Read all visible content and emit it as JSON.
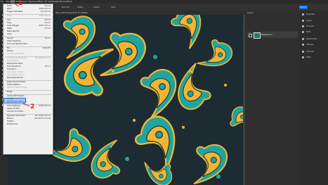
{
  "menubar": {
    "items": [
      "Ps",
      "File",
      "Edit",
      "Image",
      "Layer",
      "Type",
      "Select",
      "Filter",
      "3D",
      "View",
      "Plugins",
      "Window",
      "Help"
    ]
  },
  "options_bar": {
    "mode_label": "Normal",
    "opacity": "100%",
    "flow": "100%",
    "smoothing": "10%",
    "share": "Share"
  },
  "document": {
    "tab_title": "fiber_seamless.jpg @ 66.7% (RGB/8)"
  },
  "layers_panel": {
    "title": "Layers",
    "layer_name": "Background"
  },
  "properties_panel": {
    "items": [
      "Properties",
      "Layers",
      "Channels",
      "Paths",
      "Adjustments",
      "Libraries",
      "Channels",
      "Paths"
    ]
  },
  "edit_menu": {
    "items": [
      {
        "label": "Undo",
        "shortcut": "Ctrl+Z",
        "dim": false
      },
      {
        "label": "Redo",
        "shortcut": "Shift+Ctrl+Z",
        "dim": false
      },
      {
        "label": "Toggle Last State",
        "shortcut": "Alt+Ctrl+Z",
        "dim": false
      },
      {
        "sep": true
      },
      {
        "label": "Fade...",
        "shortcut": "Shift+Ctrl+F",
        "dim": true
      },
      {
        "sep": true
      },
      {
        "label": "Cut",
        "shortcut": "Ctrl+X",
        "dim": false
      },
      {
        "label": "Copy",
        "shortcut": "Ctrl+C",
        "dim": false
      },
      {
        "label": "Copy Merged",
        "shortcut": "Shift+Ctrl+C",
        "dim": false
      },
      {
        "label": "Paste",
        "shortcut": "Ctrl+V",
        "dim": false
      },
      {
        "label": "Paste Special",
        "shortcut": "",
        "dim": false
      },
      {
        "label": "Clear",
        "shortcut": "",
        "dim": false
      },
      {
        "sep": true
      },
      {
        "label": "Search",
        "shortcut": "Ctrl+F",
        "dim": false
      },
      {
        "label": "Check Spelling...",
        "shortcut": "",
        "dim": false
      },
      {
        "label": "Find and Replace Text...",
        "shortcut": "",
        "dim": false
      },
      {
        "sep": true
      },
      {
        "label": "Fill...",
        "shortcut": "Shift+F5",
        "dim": false
      },
      {
        "label": "Stroke...",
        "shortcut": "",
        "dim": false
      },
      {
        "label": "Content-Aware Fill...",
        "shortcut": "",
        "dim": true
      },
      {
        "sep": true
      },
      {
        "label": "Content-Aware Scale",
        "shortcut": "Alt+Shift+Ctrl+C",
        "dim": true
      },
      {
        "label": "Puppet Warp",
        "shortcut": "",
        "dim": true
      },
      {
        "label": "Perspective Warp",
        "shortcut": "",
        "dim": false
      },
      {
        "label": "Free Transform",
        "shortcut": "Ctrl+T",
        "dim": false
      },
      {
        "label": "Transform",
        "shortcut": "",
        "dim": false
      },
      {
        "label": "Auto-Align Layers...",
        "shortcut": "",
        "dim": true
      },
      {
        "label": "Auto-Blend Layers...",
        "shortcut": "",
        "dim": true
      },
      {
        "label": "Sky Replacement...",
        "shortcut": "",
        "dim": false
      },
      {
        "sep": true
      },
      {
        "label": "Define Brush Preset...",
        "shortcut": "",
        "dim": false
      },
      {
        "label": "Define Pattern...",
        "shortcut": "",
        "dim": false
      },
      {
        "label": "Define Custom Shape...",
        "shortcut": "",
        "dim": true
      },
      {
        "sep": true
      },
      {
        "label": "Purge",
        "shortcut": "",
        "dim": false
      },
      {
        "sep": true
      },
      {
        "label": "Adobe PDF Presets...",
        "shortcut": "",
        "dim": false
      },
      {
        "label": "Presets",
        "shortcut": "",
        "dim": false
      },
      {
        "label": "Remote Connections...",
        "shortcut": "",
        "dim": false
      },
      {
        "sep": true
      },
      {
        "label": "Color Settings...",
        "shortcut": "Shift+Ctrl+K",
        "dim": false
      },
      {
        "label": "Assign Profile...",
        "shortcut": "",
        "dim": false
      },
      {
        "label": "Convert to Profile...",
        "shortcut": "",
        "dim": false
      },
      {
        "sep": true
      },
      {
        "label": "Keyboard Shortcuts...",
        "shortcut": "Alt+Shift+Ctrl+K",
        "dim": false
      },
      {
        "label": "Menus...",
        "shortcut": "Alt+Shift+Ctrl+M",
        "dim": false
      },
      {
        "label": "Toolbar...",
        "shortcut": "",
        "dim": false
      },
      {
        "label": "Preferences",
        "shortcut": "",
        "dim": false
      }
    ]
  },
  "annotations": {
    "marker1": "1",
    "marker2": "2",
    "color": "#e02020"
  },
  "colors": {
    "canvas_bg": "#1d2b33",
    "paisley_teal": "#1fa5a0",
    "paisley_yellow": "#f2b531",
    "accent_blue": "#1473e6"
  }
}
